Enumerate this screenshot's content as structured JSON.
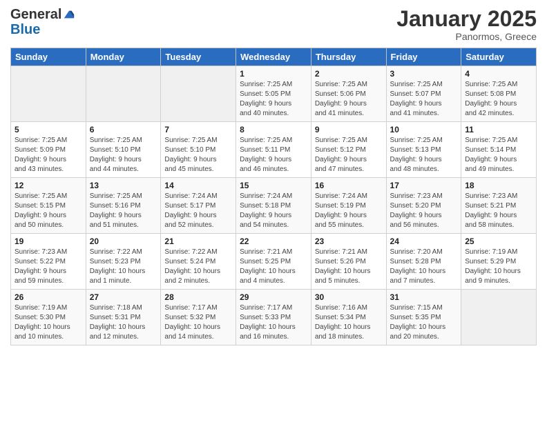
{
  "header": {
    "logo_general": "General",
    "logo_blue": "Blue",
    "month_title": "January 2025",
    "location": "Panormos, Greece"
  },
  "weekdays": [
    "Sunday",
    "Monday",
    "Tuesday",
    "Wednesday",
    "Thursday",
    "Friday",
    "Saturday"
  ],
  "weeks": [
    [
      {
        "day": "",
        "info": ""
      },
      {
        "day": "",
        "info": ""
      },
      {
        "day": "",
        "info": ""
      },
      {
        "day": "1",
        "info": "Sunrise: 7:25 AM\nSunset: 5:05 PM\nDaylight: 9 hours\nand 40 minutes."
      },
      {
        "day": "2",
        "info": "Sunrise: 7:25 AM\nSunset: 5:06 PM\nDaylight: 9 hours\nand 41 minutes."
      },
      {
        "day": "3",
        "info": "Sunrise: 7:25 AM\nSunset: 5:07 PM\nDaylight: 9 hours\nand 41 minutes."
      },
      {
        "day": "4",
        "info": "Sunrise: 7:25 AM\nSunset: 5:08 PM\nDaylight: 9 hours\nand 42 minutes."
      }
    ],
    [
      {
        "day": "5",
        "info": "Sunrise: 7:25 AM\nSunset: 5:09 PM\nDaylight: 9 hours\nand 43 minutes."
      },
      {
        "day": "6",
        "info": "Sunrise: 7:25 AM\nSunset: 5:10 PM\nDaylight: 9 hours\nand 44 minutes."
      },
      {
        "day": "7",
        "info": "Sunrise: 7:25 AM\nSunset: 5:10 PM\nDaylight: 9 hours\nand 45 minutes."
      },
      {
        "day": "8",
        "info": "Sunrise: 7:25 AM\nSunset: 5:11 PM\nDaylight: 9 hours\nand 46 minutes."
      },
      {
        "day": "9",
        "info": "Sunrise: 7:25 AM\nSunset: 5:12 PM\nDaylight: 9 hours\nand 47 minutes."
      },
      {
        "day": "10",
        "info": "Sunrise: 7:25 AM\nSunset: 5:13 PM\nDaylight: 9 hours\nand 48 minutes."
      },
      {
        "day": "11",
        "info": "Sunrise: 7:25 AM\nSunset: 5:14 PM\nDaylight: 9 hours\nand 49 minutes."
      }
    ],
    [
      {
        "day": "12",
        "info": "Sunrise: 7:25 AM\nSunset: 5:15 PM\nDaylight: 9 hours\nand 50 minutes."
      },
      {
        "day": "13",
        "info": "Sunrise: 7:25 AM\nSunset: 5:16 PM\nDaylight: 9 hours\nand 51 minutes."
      },
      {
        "day": "14",
        "info": "Sunrise: 7:24 AM\nSunset: 5:17 PM\nDaylight: 9 hours\nand 52 minutes."
      },
      {
        "day": "15",
        "info": "Sunrise: 7:24 AM\nSunset: 5:18 PM\nDaylight: 9 hours\nand 54 minutes."
      },
      {
        "day": "16",
        "info": "Sunrise: 7:24 AM\nSunset: 5:19 PM\nDaylight: 9 hours\nand 55 minutes."
      },
      {
        "day": "17",
        "info": "Sunrise: 7:23 AM\nSunset: 5:20 PM\nDaylight: 9 hours\nand 56 minutes."
      },
      {
        "day": "18",
        "info": "Sunrise: 7:23 AM\nSunset: 5:21 PM\nDaylight: 9 hours\nand 58 minutes."
      }
    ],
    [
      {
        "day": "19",
        "info": "Sunrise: 7:23 AM\nSunset: 5:22 PM\nDaylight: 9 hours\nand 59 minutes."
      },
      {
        "day": "20",
        "info": "Sunrise: 7:22 AM\nSunset: 5:23 PM\nDaylight: 10 hours\nand 1 minute."
      },
      {
        "day": "21",
        "info": "Sunrise: 7:22 AM\nSunset: 5:24 PM\nDaylight: 10 hours\nand 2 minutes."
      },
      {
        "day": "22",
        "info": "Sunrise: 7:21 AM\nSunset: 5:25 PM\nDaylight: 10 hours\nand 4 minutes."
      },
      {
        "day": "23",
        "info": "Sunrise: 7:21 AM\nSunset: 5:26 PM\nDaylight: 10 hours\nand 5 minutes."
      },
      {
        "day": "24",
        "info": "Sunrise: 7:20 AM\nSunset: 5:28 PM\nDaylight: 10 hours\nand 7 minutes."
      },
      {
        "day": "25",
        "info": "Sunrise: 7:19 AM\nSunset: 5:29 PM\nDaylight: 10 hours\nand 9 minutes."
      }
    ],
    [
      {
        "day": "26",
        "info": "Sunrise: 7:19 AM\nSunset: 5:30 PM\nDaylight: 10 hours\nand 10 minutes."
      },
      {
        "day": "27",
        "info": "Sunrise: 7:18 AM\nSunset: 5:31 PM\nDaylight: 10 hours\nand 12 minutes."
      },
      {
        "day": "28",
        "info": "Sunrise: 7:17 AM\nSunset: 5:32 PM\nDaylight: 10 hours\nand 14 minutes."
      },
      {
        "day": "29",
        "info": "Sunrise: 7:17 AM\nSunset: 5:33 PM\nDaylight: 10 hours\nand 16 minutes."
      },
      {
        "day": "30",
        "info": "Sunrise: 7:16 AM\nSunset: 5:34 PM\nDaylight: 10 hours\nand 18 minutes."
      },
      {
        "day": "31",
        "info": "Sunrise: 7:15 AM\nSunset: 5:35 PM\nDaylight: 10 hours\nand 20 minutes."
      },
      {
        "day": "",
        "info": ""
      }
    ]
  ]
}
